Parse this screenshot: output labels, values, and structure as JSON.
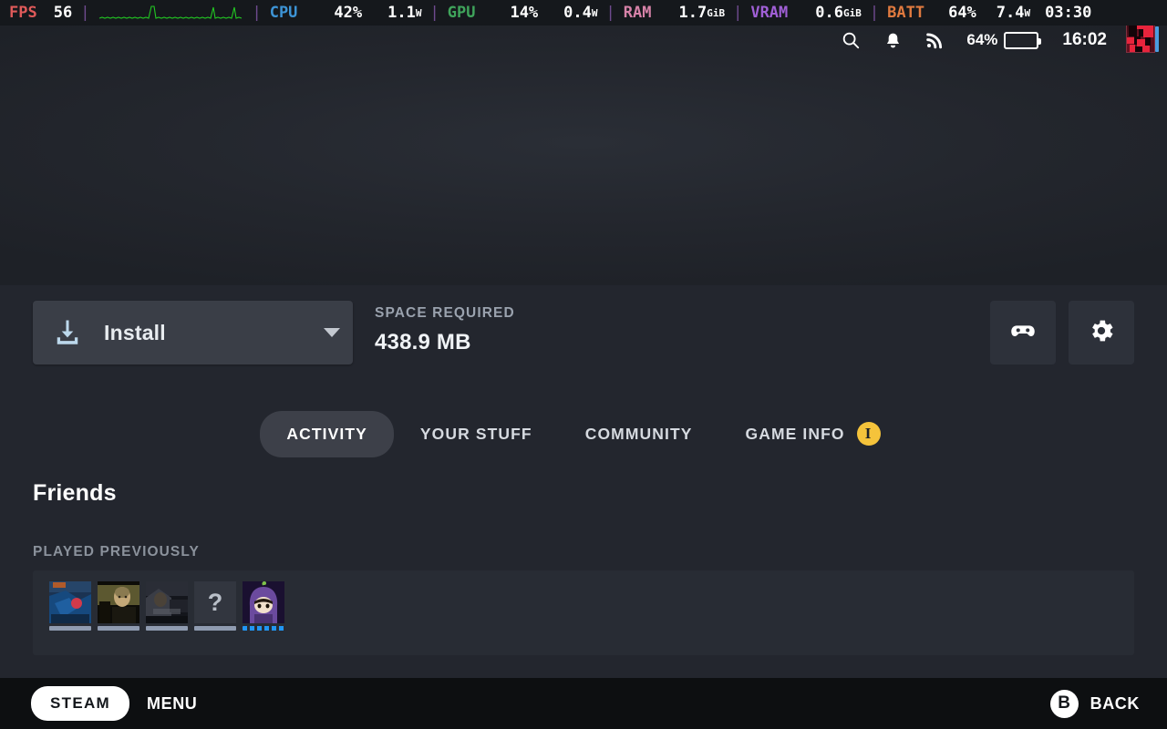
{
  "perf_overlay": {
    "fps": {
      "label": "FPS",
      "value": "56"
    },
    "cpu": {
      "label": "CPU",
      "percent": "42%",
      "watts": "1.1",
      "watt_unit": "W"
    },
    "gpu": {
      "label": "GPU",
      "percent": "14%",
      "watts": "0.4",
      "watt_unit": "W"
    },
    "ram": {
      "label": "RAM",
      "value": "1.7",
      "unit": "GiB"
    },
    "vram": {
      "label": "VRAM",
      "value": "0.6",
      "unit": "GiB"
    },
    "batt": {
      "label": "BATT",
      "percent": "64%",
      "watts": "7.4",
      "watt_unit": "W",
      "time": "03:30"
    }
  },
  "tray": {
    "search_icon": "search-icon",
    "notifications_icon": "bell-icon",
    "network_icon": "wifi-icon",
    "battery_percent": "64%",
    "battery_level": 64,
    "clock": "16:02",
    "avatar": "user-avatar"
  },
  "actions": {
    "install_label": "Install",
    "install_icon": "download-icon",
    "dropdown_icon": "chevron-down-icon",
    "space_required_label": "SPACE REQUIRED",
    "space_required_value": "438.9 MB",
    "controller_button": "gamepad-icon",
    "settings_button": "gear-icon"
  },
  "tabs": [
    {
      "label": "ACTIVITY",
      "active": true
    },
    {
      "label": "YOUR STUFF",
      "active": false
    },
    {
      "label": "COMMUNITY",
      "active": false
    },
    {
      "label": "GAME INFO",
      "active": false,
      "badge": "i"
    }
  ],
  "friends": {
    "heading": "Friends",
    "section_label": "PLAYED PREVIOUSLY",
    "avatars": [
      {
        "name": "friend-avatar-1",
        "status": "offline"
      },
      {
        "name": "friend-avatar-2",
        "status": "offline"
      },
      {
        "name": "friend-avatar-3",
        "status": "offline"
      },
      {
        "name": "friend-avatar-4",
        "status": "offline",
        "placeholder": "?"
      },
      {
        "name": "friend-avatar-5",
        "status": "online"
      }
    ]
  },
  "footer": {
    "steam_label": "STEAM",
    "menu_label": "MENU",
    "back_button_glyph": "B",
    "back_label": "BACK"
  },
  "colors": {
    "accent_yellow": "#f5c33b",
    "online_blue": "#2196f3",
    "battery_green": "#4caf50",
    "fps_red": "#e05a5a",
    "cpu_blue": "#3d94d6",
    "gpu_green": "#3fa45b",
    "ram_pink": "#d682a8",
    "vram_purple": "#a05fd6",
    "batt_orange": "#e07a3f",
    "panel_bg": "#282c34",
    "main_bg": "#23262e"
  }
}
